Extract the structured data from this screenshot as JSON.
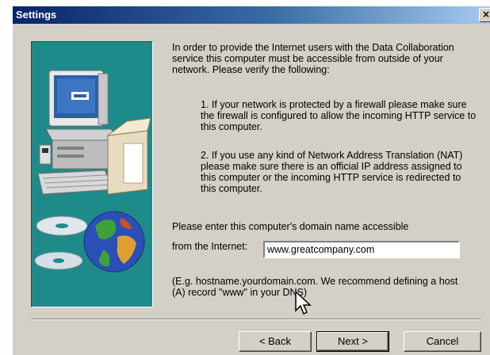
{
  "window": {
    "title": "Settings",
    "close_glyph": "×"
  },
  "content": {
    "intro": "In order to provide the Internet users with the Data Collaboration service this computer must be accessible from outside of your network. Please verify the following:",
    "item1": "1. If your network is protected by a firewall please make sure the firewall is configured to allow the incoming HTTP service to this computer.",
    "item2": "2. If you use any kind of Network Address Translation (NAT) please make sure there is an official IP address assigned to this computer or the incoming HTTP service is redirected to this computer.",
    "prompt_line1": "Please enter this computer's domain name accessible",
    "prompt_line2": "from the Internet:",
    "example": "(E.g. hostname.yourdomain.com. We recommend defining a host (A) record \"www\" in your DNS)"
  },
  "domain_field": {
    "value": "www.greatcompany.com"
  },
  "buttons": {
    "back": "< Back",
    "next": "Next >",
    "cancel": "Cancel"
  },
  "icons": {
    "illustration": "computer-globe-cd-illustration",
    "cursor": "arrow-cursor-icon",
    "close": "close-icon"
  },
  "colors": {
    "title_bar": "#0a246a",
    "dialog_bg": "#d4d0c8",
    "illustration_bg": "#1f8a8a"
  }
}
